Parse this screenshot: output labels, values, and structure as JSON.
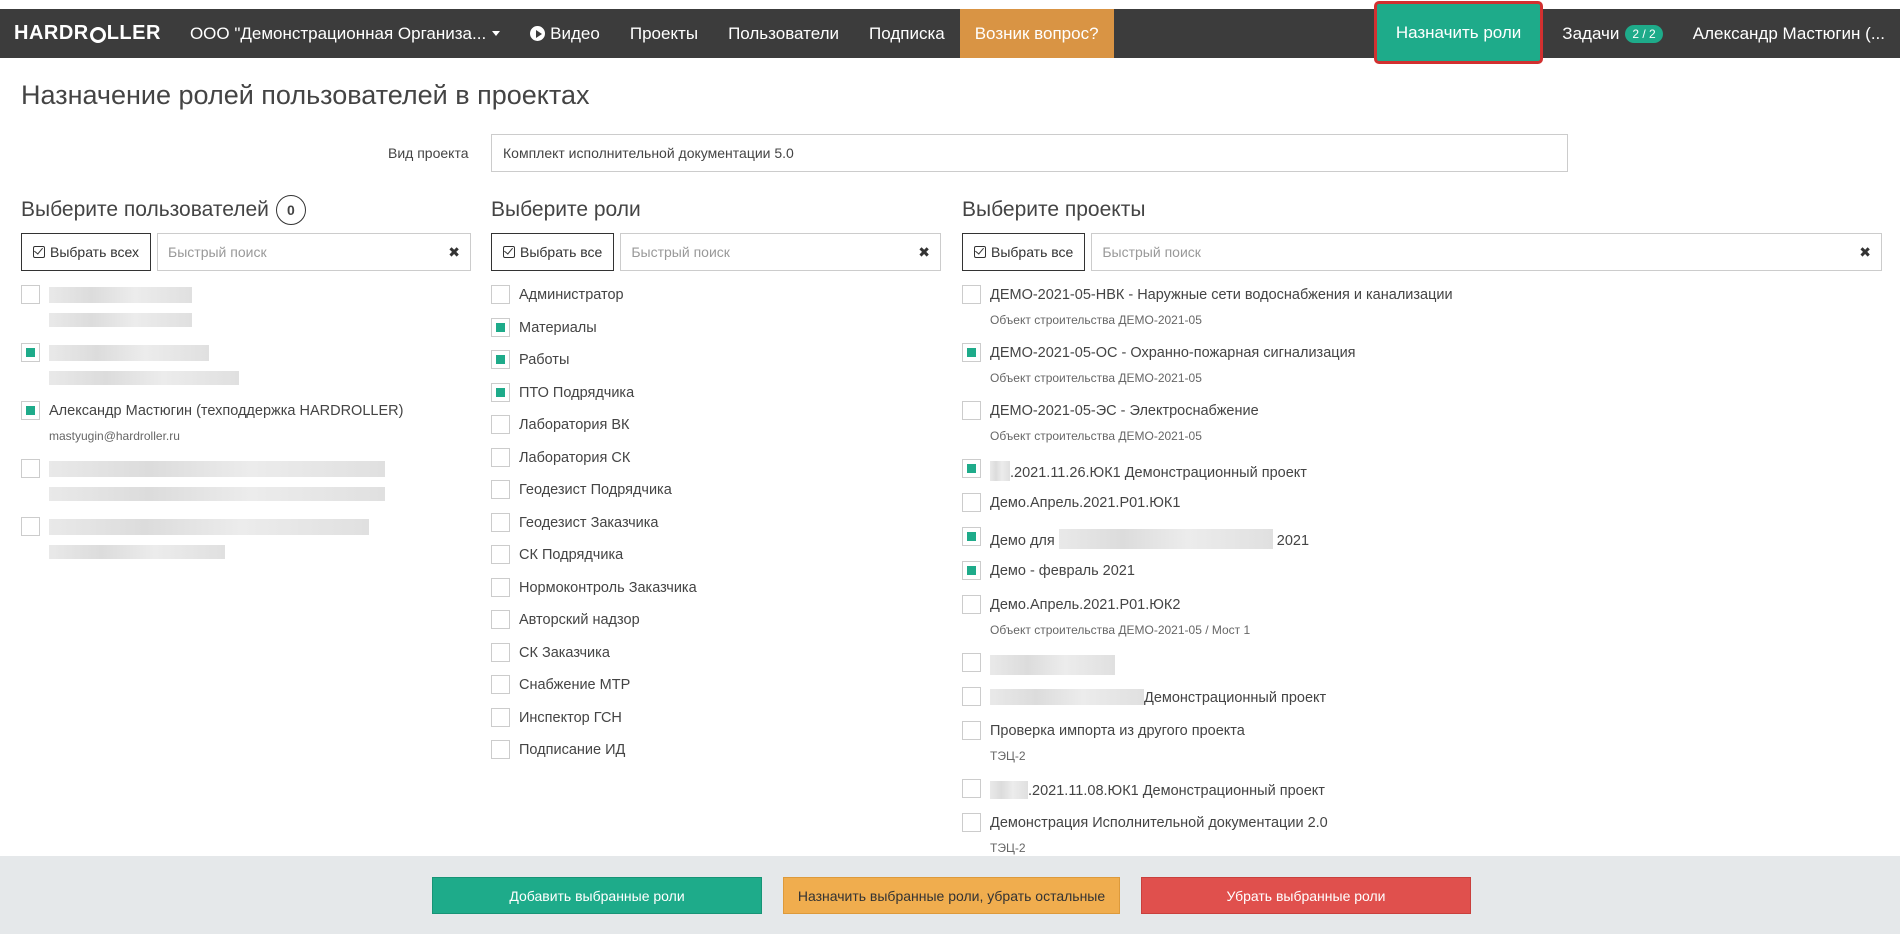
{
  "navbar": {
    "brand": "HARDROLLER",
    "org": "ООО \"Демонстрационная Организа...",
    "video": "Видео",
    "projects": "Проекты",
    "users": "Пользователи",
    "subscription": "Подписка",
    "question": "Возник вопрос?",
    "assign_roles": "Назначить роли",
    "tasks": "Задачи",
    "tasks_badge": "2 / 2",
    "user_name": "Александр Мастюгин (..."
  },
  "page": {
    "title": "Назначение ролей пользователей в проектах",
    "project_type_label": "Вид проекта",
    "project_type_value": "Комплект исполнительной документации 5.0"
  },
  "users_col": {
    "title": "Выберите пользователей",
    "count": "0",
    "select_all": "Выбрать всех",
    "search_placeholder": "Быстрый поиск",
    "items": [
      {
        "checked": false,
        "name": "",
        "email": ""
      },
      {
        "checked": true,
        "name": "",
        "email": ""
      },
      {
        "checked": true,
        "name": "Александр Мастюгин (техподдержка HARDROLLER)",
        "email": "mastyugin@hardroller.ru"
      },
      {
        "checked": false,
        "name": "",
        "email": ""
      },
      {
        "checked": false,
        "name": "",
        "email": ""
      }
    ]
  },
  "roles_col": {
    "title": "Выберите роли",
    "select_all": "Выбрать все",
    "search_placeholder": "Быстрый поиск",
    "items": [
      {
        "checked": false,
        "label": "Администратор"
      },
      {
        "checked": true,
        "label": "Материалы"
      },
      {
        "checked": true,
        "label": "Работы"
      },
      {
        "checked": true,
        "label": "ПТО Подрядчика"
      },
      {
        "checked": false,
        "label": "Лаборатория ВК"
      },
      {
        "checked": false,
        "label": "Лаборатория СК"
      },
      {
        "checked": false,
        "label": "Геодезист Подрядчика"
      },
      {
        "checked": false,
        "label": "Геодезист Заказчика"
      },
      {
        "checked": false,
        "label": "СК Подрядчика"
      },
      {
        "checked": false,
        "label": "Нормоконтроль Заказчика"
      },
      {
        "checked": false,
        "label": "Авторский надзор"
      },
      {
        "checked": false,
        "label": "СК Заказчика"
      },
      {
        "checked": false,
        "label": "Снабжение МТР"
      },
      {
        "checked": false,
        "label": "Инспектор ГСН"
      },
      {
        "checked": false,
        "label": "Подписание ИД"
      }
    ]
  },
  "projects_col": {
    "title": "Выберите проекты",
    "select_all": "Выбрать все",
    "search_placeholder": "Быстрый поиск",
    "items": [
      {
        "checked": false,
        "label": "ДЕМО-2021-05-НВК - Наружные сети водоснабжения и канализации",
        "sub": "Объект строительства ДЕМО-2021-05"
      },
      {
        "checked": true,
        "label": "ДЕМО-2021-05-ОС - Охранно-пожарная сигнализация",
        "sub": "Объект строительства ДЕМО-2021-05"
      },
      {
        "checked": false,
        "label": "ДЕМО-2021-05-ЭС - Электроснабжение",
        "sub": "Объект строительства ДЕМО-2021-05"
      },
      {
        "checked": true,
        "label": ".2021.11.26.ЮК1 Демонстрационный проект",
        "sub": ""
      },
      {
        "checked": false,
        "label": "Демо.Апрель.2021.Р01.ЮК1",
        "sub": ""
      },
      {
        "checked": true,
        "label": "Демо для",
        "label_tail": "2021",
        "sub": ""
      },
      {
        "checked": true,
        "label": "Демо - февраль 2021",
        "sub": ""
      },
      {
        "checked": false,
        "label": "Демо.Апрель.2021.Р01.ЮК2",
        "sub": "Объект строительства ДЕМО-2021-05 / Мост 1"
      },
      {
        "checked": false,
        "label": "",
        "sub": ""
      },
      {
        "checked": false,
        "label": "Демонстрационный проект",
        "sub": ""
      },
      {
        "checked": false,
        "label": "Проверка импорта из другого проекта",
        "sub": "ТЭЦ-2"
      },
      {
        "checked": false,
        "label": ".2021.11.08.ЮК1 Демонстрационный проект",
        "sub": ""
      },
      {
        "checked": false,
        "label": "Демонстрация Исполнительной документации 2.0",
        "sub": "ТЭЦ-2"
      }
    ]
  },
  "footer": {
    "add": "Добавить выбранные роли",
    "set": "Назначить выбранные роли, убрать остальные",
    "remove": "Убрать выбранные роли"
  }
}
